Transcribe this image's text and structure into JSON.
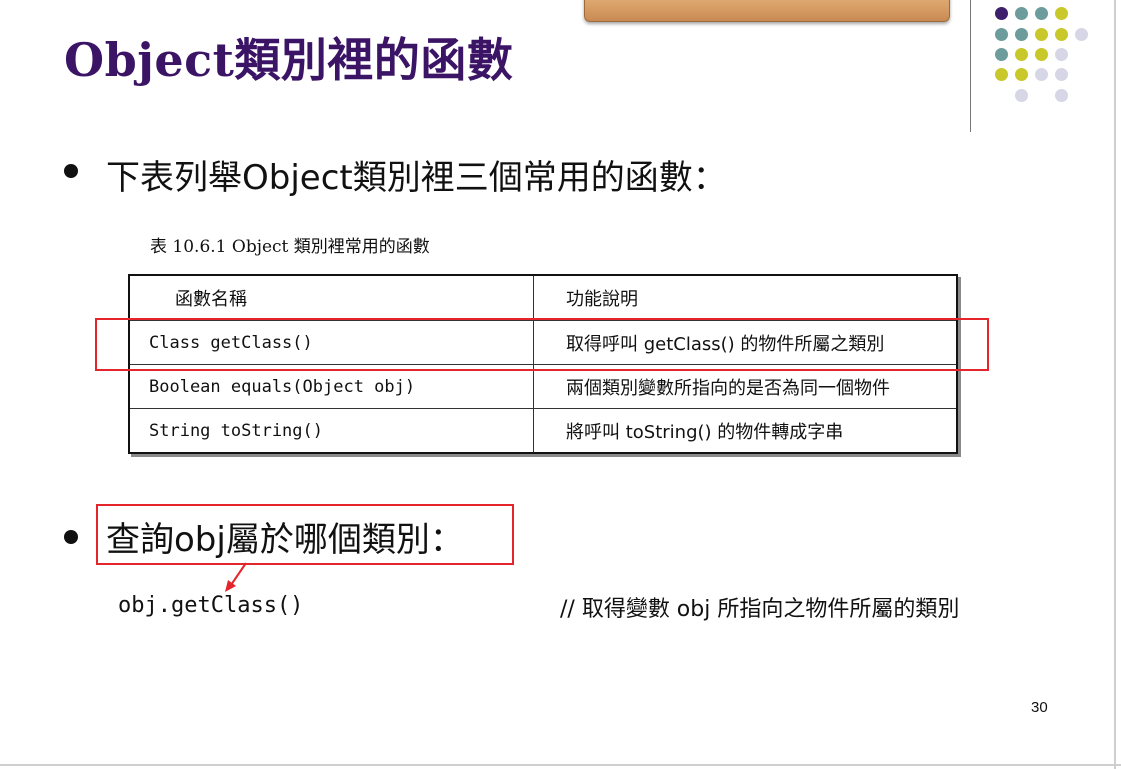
{
  "slide": {
    "title": "Object類別裡的函數",
    "page_number": "30"
  },
  "bullets": [
    {
      "text": "下表列舉Object類別裡三個常用的函數："
    },
    {
      "text": "查詢obj屬於哪個類別："
    }
  ],
  "table": {
    "caption": "表 10.6.1 Object 類別裡常用的函數",
    "headers": [
      "函數名稱",
      "功能說明"
    ],
    "rows": [
      {
        "name": "Class getClass()",
        "desc": "取得呼叫 getClass() 的物件所屬之類別"
      },
      {
        "name": "Boolean equals(Object obj)",
        "desc": "兩個類別變數所指向的是否為同一個物件"
      },
      {
        "name": "String toString()",
        "desc": "將呼叫 toString() 的物件轉成字串"
      }
    ]
  },
  "code_example": {
    "code": "obj.getClass()",
    "comment": "// 取得變數 obj 所指向之物件所屬的類別"
  },
  "colors": {
    "title": "#3b1466",
    "highlight_red": "#e4252b",
    "dot_purple": "#3e1f6b",
    "dot_teal": "#6c9c9c",
    "dot_olive": "#c8c82a",
    "dot_lavender": "#d6d6e6"
  }
}
